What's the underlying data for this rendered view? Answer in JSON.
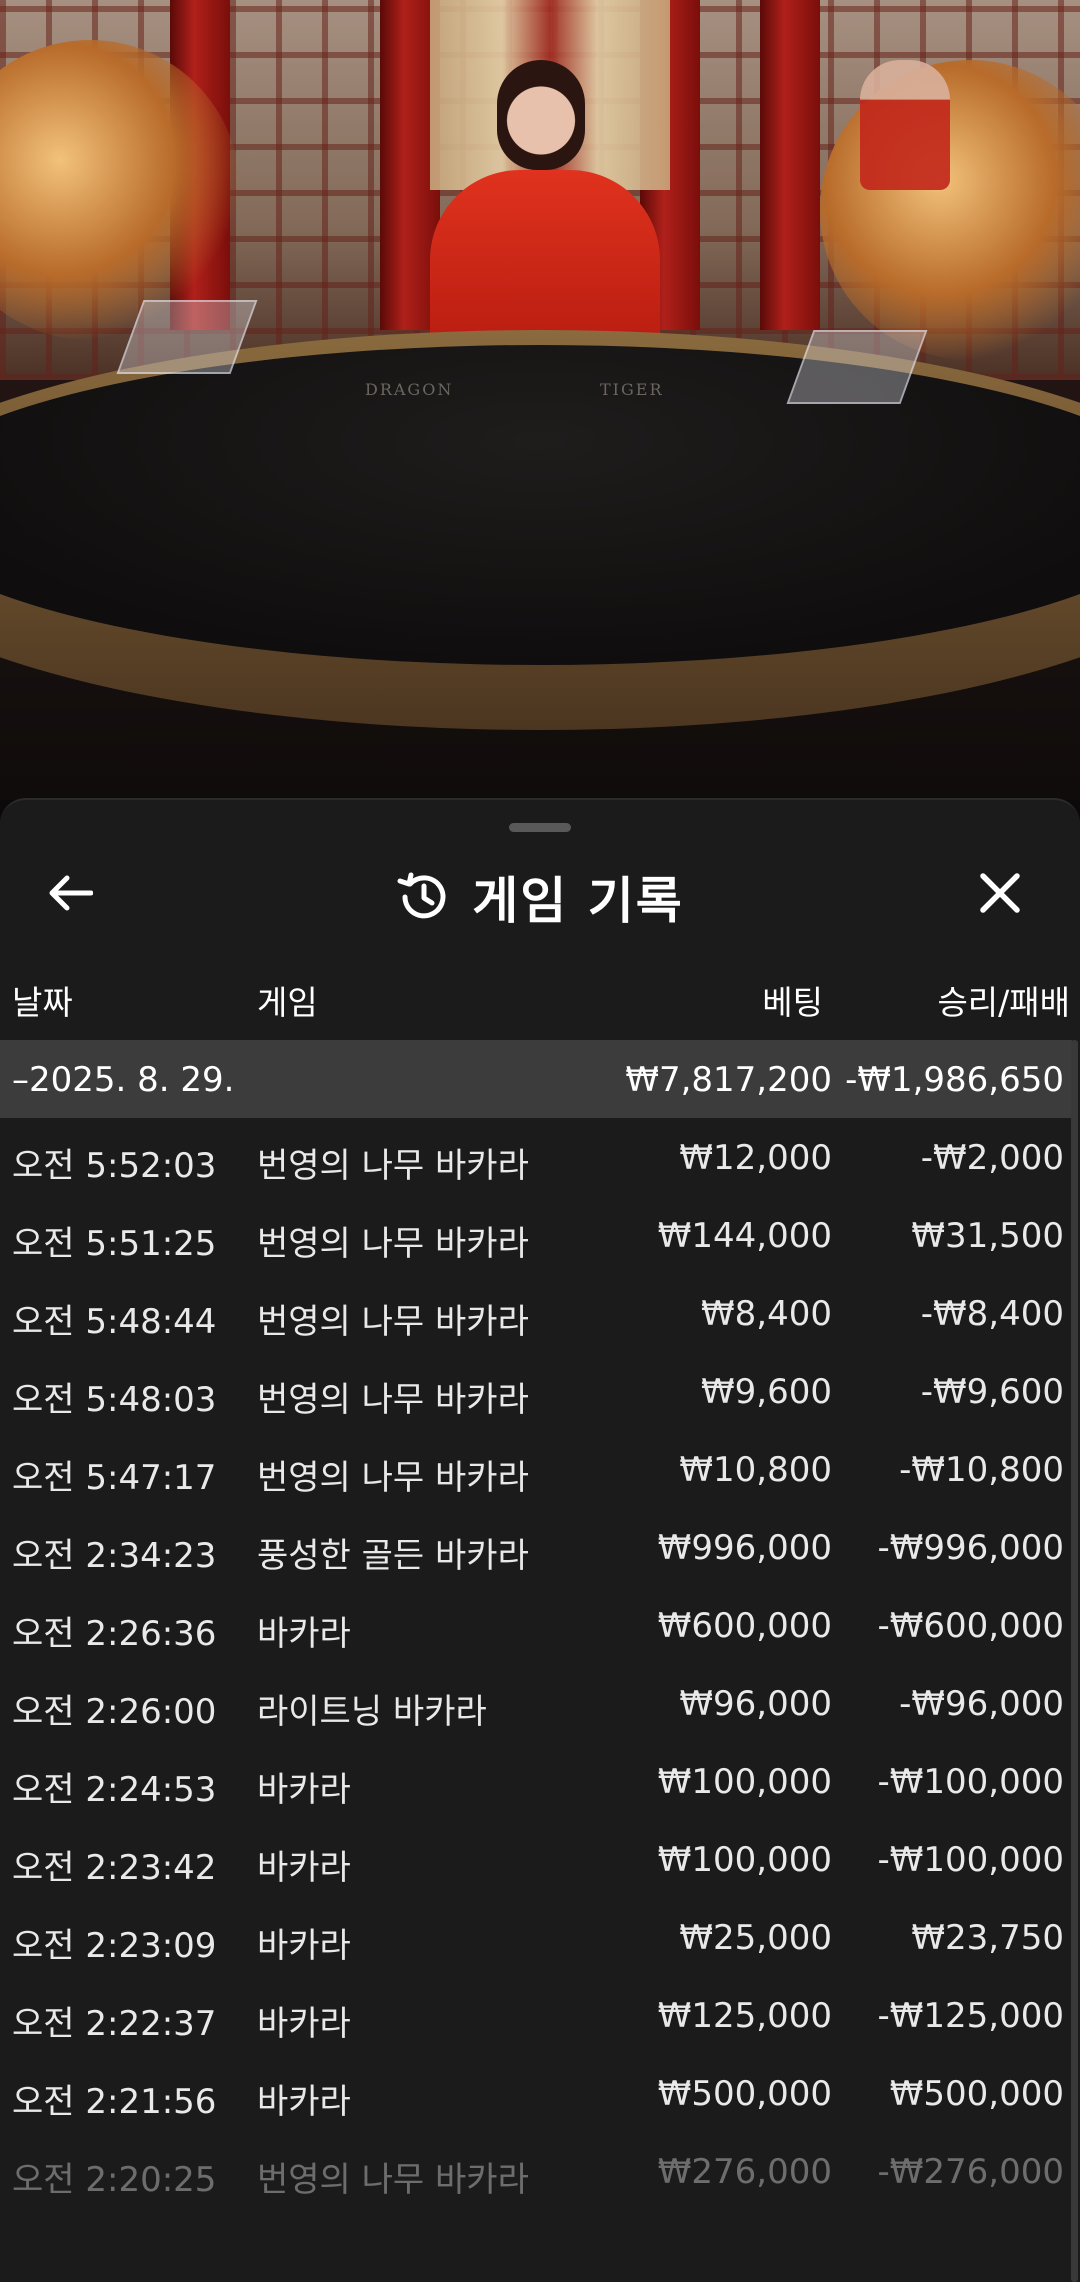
{
  "sheet": {
    "title": "게임 기록",
    "icons": {
      "back": "arrow-left-icon",
      "history": "history-clock-icon",
      "close": "close-x-icon"
    }
  },
  "table_felt": {
    "dragon_label": "DRAGON",
    "tiger_label": "TIGER"
  },
  "columns": {
    "date": "날짜",
    "game": "게임",
    "bet": "베팅",
    "result": "승리/패배"
  },
  "summary": {
    "date": "–2025. 8. 29.",
    "bet": "₩7,817,200",
    "result": "-₩1,986,650"
  },
  "rows": [
    {
      "time": "오전 5:52:03",
      "game": "번영의 나무 바카라",
      "bet": "₩12,000",
      "result": "-₩2,000"
    },
    {
      "time": "오전 5:51:25",
      "game": "번영의 나무 바카라",
      "bet": "₩144,000",
      "result": "₩31,500"
    },
    {
      "time": "오전 5:48:44",
      "game": "번영의 나무 바카라",
      "bet": "₩8,400",
      "result": "-₩8,400"
    },
    {
      "time": "오전 5:48:03",
      "game": "번영의 나무 바카라",
      "bet": "₩9,600",
      "result": "-₩9,600"
    },
    {
      "time": "오전 5:47:17",
      "game": "번영의 나무 바카라",
      "bet": "₩10,800",
      "result": "-₩10,800"
    },
    {
      "time": "오전 2:34:23",
      "game": "풍성한 골든 바카라",
      "bet": "₩996,000",
      "result": "-₩996,000"
    },
    {
      "time": "오전 2:26:36",
      "game": "바카라",
      "bet": "₩600,000",
      "result": "-₩600,000"
    },
    {
      "time": "오전 2:26:00",
      "game": "라이트닝 바카라",
      "bet": "₩96,000",
      "result": "-₩96,000"
    },
    {
      "time": "오전 2:24:53",
      "game": "바카라",
      "bet": "₩100,000",
      "result": "-₩100,000"
    },
    {
      "time": "오전 2:23:42",
      "game": "바카라",
      "bet": "₩100,000",
      "result": "-₩100,000"
    },
    {
      "time": "오전 2:23:09",
      "game": "바카라",
      "bet": "₩25,000",
      "result": "₩23,750"
    },
    {
      "time": "오전 2:22:37",
      "game": "바카라",
      "bet": "₩125,000",
      "result": "-₩125,000"
    },
    {
      "time": "오전 2:21:56",
      "game": "바카라",
      "bet": "₩500,000",
      "result": "₩500,000"
    },
    {
      "time": "오전 2:20:25",
      "game": "번영의 나무 바카라",
      "bet": "₩276,000",
      "result": "-₩276,000"
    }
  ]
}
